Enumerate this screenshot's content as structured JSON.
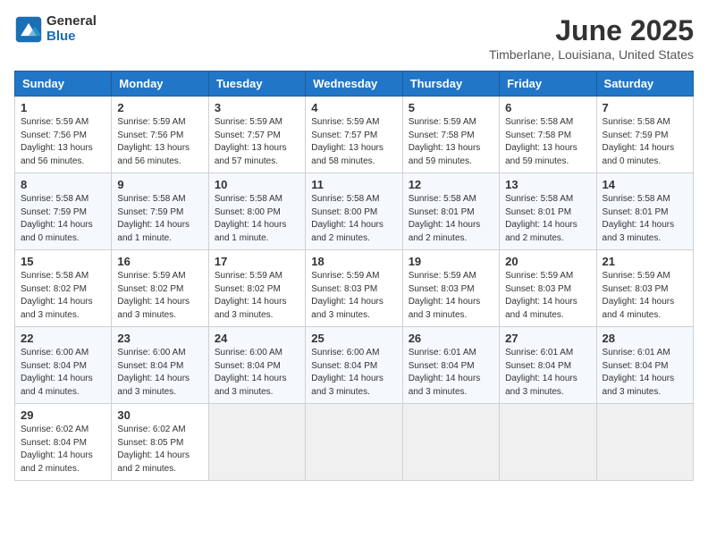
{
  "logo": {
    "general": "General",
    "blue": "Blue"
  },
  "title": "June 2025",
  "subtitle": "Timberlane, Louisiana, United States",
  "days_of_week": [
    "Sunday",
    "Monday",
    "Tuesday",
    "Wednesday",
    "Thursday",
    "Friday",
    "Saturday"
  ],
  "weeks": [
    [
      {
        "day": "1",
        "info": "Sunrise: 5:59 AM\nSunset: 7:56 PM\nDaylight: 13 hours\nand 56 minutes."
      },
      {
        "day": "2",
        "info": "Sunrise: 5:59 AM\nSunset: 7:56 PM\nDaylight: 13 hours\nand 56 minutes."
      },
      {
        "day": "3",
        "info": "Sunrise: 5:59 AM\nSunset: 7:57 PM\nDaylight: 13 hours\nand 57 minutes."
      },
      {
        "day": "4",
        "info": "Sunrise: 5:59 AM\nSunset: 7:57 PM\nDaylight: 13 hours\nand 58 minutes."
      },
      {
        "day": "5",
        "info": "Sunrise: 5:59 AM\nSunset: 7:58 PM\nDaylight: 13 hours\nand 59 minutes."
      },
      {
        "day": "6",
        "info": "Sunrise: 5:58 AM\nSunset: 7:58 PM\nDaylight: 13 hours\nand 59 minutes."
      },
      {
        "day": "7",
        "info": "Sunrise: 5:58 AM\nSunset: 7:59 PM\nDaylight: 14 hours\nand 0 minutes."
      }
    ],
    [
      {
        "day": "8",
        "info": "Sunrise: 5:58 AM\nSunset: 7:59 PM\nDaylight: 14 hours\nand 0 minutes."
      },
      {
        "day": "9",
        "info": "Sunrise: 5:58 AM\nSunset: 7:59 PM\nDaylight: 14 hours\nand 1 minute."
      },
      {
        "day": "10",
        "info": "Sunrise: 5:58 AM\nSunset: 8:00 PM\nDaylight: 14 hours\nand 1 minute."
      },
      {
        "day": "11",
        "info": "Sunrise: 5:58 AM\nSunset: 8:00 PM\nDaylight: 14 hours\nand 2 minutes."
      },
      {
        "day": "12",
        "info": "Sunrise: 5:58 AM\nSunset: 8:01 PM\nDaylight: 14 hours\nand 2 minutes."
      },
      {
        "day": "13",
        "info": "Sunrise: 5:58 AM\nSunset: 8:01 PM\nDaylight: 14 hours\nand 2 minutes."
      },
      {
        "day": "14",
        "info": "Sunrise: 5:58 AM\nSunset: 8:01 PM\nDaylight: 14 hours\nand 3 minutes."
      }
    ],
    [
      {
        "day": "15",
        "info": "Sunrise: 5:58 AM\nSunset: 8:02 PM\nDaylight: 14 hours\nand 3 minutes."
      },
      {
        "day": "16",
        "info": "Sunrise: 5:59 AM\nSunset: 8:02 PM\nDaylight: 14 hours\nand 3 minutes."
      },
      {
        "day": "17",
        "info": "Sunrise: 5:59 AM\nSunset: 8:02 PM\nDaylight: 14 hours\nand 3 minutes."
      },
      {
        "day": "18",
        "info": "Sunrise: 5:59 AM\nSunset: 8:03 PM\nDaylight: 14 hours\nand 3 minutes."
      },
      {
        "day": "19",
        "info": "Sunrise: 5:59 AM\nSunset: 8:03 PM\nDaylight: 14 hours\nand 3 minutes."
      },
      {
        "day": "20",
        "info": "Sunrise: 5:59 AM\nSunset: 8:03 PM\nDaylight: 14 hours\nand 4 minutes."
      },
      {
        "day": "21",
        "info": "Sunrise: 5:59 AM\nSunset: 8:03 PM\nDaylight: 14 hours\nand 4 minutes."
      }
    ],
    [
      {
        "day": "22",
        "info": "Sunrise: 6:00 AM\nSunset: 8:04 PM\nDaylight: 14 hours\nand 4 minutes."
      },
      {
        "day": "23",
        "info": "Sunrise: 6:00 AM\nSunset: 8:04 PM\nDaylight: 14 hours\nand 3 minutes."
      },
      {
        "day": "24",
        "info": "Sunrise: 6:00 AM\nSunset: 8:04 PM\nDaylight: 14 hours\nand 3 minutes."
      },
      {
        "day": "25",
        "info": "Sunrise: 6:00 AM\nSunset: 8:04 PM\nDaylight: 14 hours\nand 3 minutes."
      },
      {
        "day": "26",
        "info": "Sunrise: 6:01 AM\nSunset: 8:04 PM\nDaylight: 14 hours\nand 3 minutes."
      },
      {
        "day": "27",
        "info": "Sunrise: 6:01 AM\nSunset: 8:04 PM\nDaylight: 14 hours\nand 3 minutes."
      },
      {
        "day": "28",
        "info": "Sunrise: 6:01 AM\nSunset: 8:04 PM\nDaylight: 14 hours\nand 3 minutes."
      }
    ],
    [
      {
        "day": "29",
        "info": "Sunrise: 6:02 AM\nSunset: 8:04 PM\nDaylight: 14 hours\nand 2 minutes."
      },
      {
        "day": "30",
        "info": "Sunrise: 6:02 AM\nSunset: 8:05 PM\nDaylight: 14 hours\nand 2 minutes."
      },
      {
        "day": "",
        "info": ""
      },
      {
        "day": "",
        "info": ""
      },
      {
        "day": "",
        "info": ""
      },
      {
        "day": "",
        "info": ""
      },
      {
        "day": "",
        "info": ""
      }
    ]
  ]
}
